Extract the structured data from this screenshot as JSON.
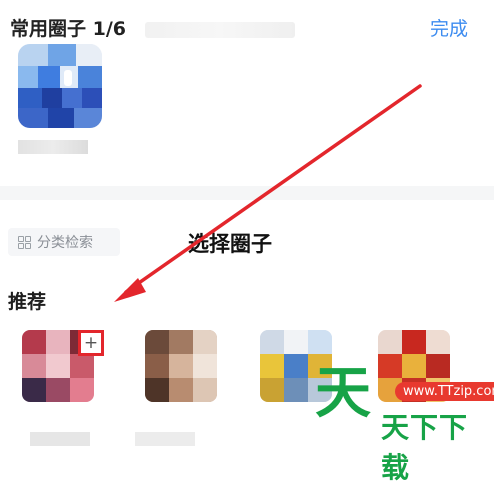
{
  "header": {
    "title": "常用圈子 1/6",
    "done_label": "完成"
  },
  "frequent": {
    "items": [
      {
        "name": ""
      }
    ]
  },
  "filter": {
    "category_search_label": "分类检索",
    "grid_icon": "grid-icon"
  },
  "main": {
    "select_title": "选择圈子",
    "recommend_label": "推荐",
    "add_button_label": "+"
  },
  "recommended": {
    "items": [
      {
        "name": "",
        "icon": "avatar"
      },
      {
        "name": "",
        "icon": "avatar"
      },
      {
        "name": "",
        "icon": "avatar"
      },
      {
        "name": "",
        "icon": "avatar"
      }
    ]
  },
  "watermark": {
    "logo_glyph": "天",
    "url": "www.TTzip.com",
    "text": "天下下载"
  },
  "colors": {
    "accent_blue": "#3d8cf0",
    "annotation_red": "#e3262c",
    "watermark_green": "#17a347"
  }
}
